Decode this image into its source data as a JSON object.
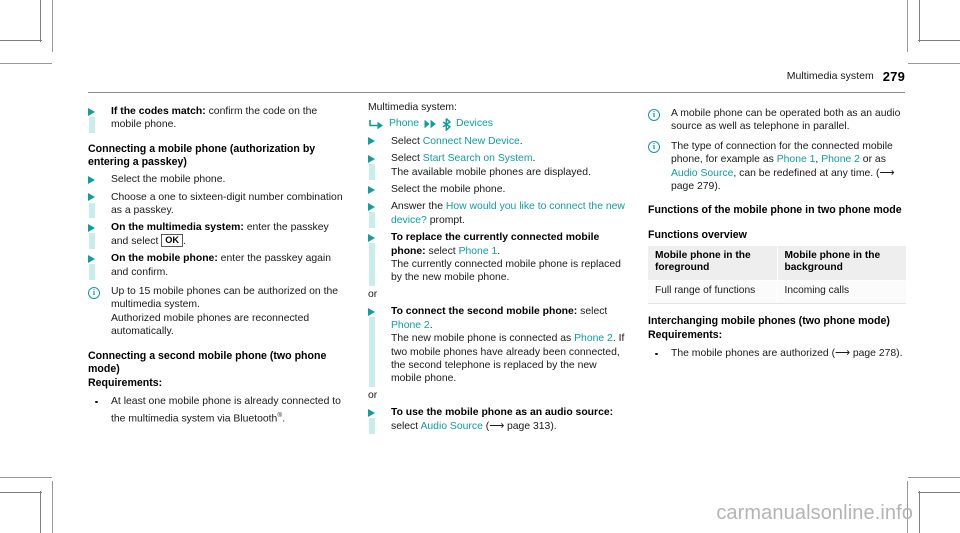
{
  "header": {
    "chapter": "Multimedia system",
    "page_number": "279"
  },
  "watermark": "carmanualsonline.info",
  "column1": {
    "step_codes_match": {
      "bold": "If the codes match:",
      "rest": " confirm the code on the mobile phone."
    },
    "heading_connect_passkey": "Connecting a mobile phone (authorization by entering a passkey)",
    "step_select_phone": "Select the mobile phone.",
    "step_choose_number": "Choose a one to sixteen-digit number combination as a passkey.",
    "step_multimedia": {
      "bold": "On the multimedia system:",
      "rest": " enter the passkey and select ",
      "key": "OK",
      "tail": "."
    },
    "step_mobile_phone": {
      "bold": "On the mobile phone:",
      "rest": " enter the passkey again and confirm."
    },
    "note_up_to_15": "Up to 15 mobile phones can be authorized on the multimedia system.\nAuthorized mobile phones are reconnected automatically.",
    "note_up_to_15_line1": "Up to 15 mobile phones can be authorized on the multimedia system.",
    "note_up_to_15_line2": "Authorized mobile phones are reconnected automatically.",
    "heading_second_phone": "Connecting a second mobile phone (two phone mode)",
    "heading_requirements": "Requirements:",
    "requirement_1": {
      "text_before": "At least one mobile phone is already connected to the multimedia system via Bluetooth",
      "superscript": "®",
      "text_after": "."
    }
  },
  "column2": {
    "intro": "Multimedia system:",
    "menu_path": {
      "turn_arrow_icon": "turn-arrow-icon",
      "item1": "Phone",
      "chevron_icon": "double-chevron-right-icon",
      "bluetooth_icon": "bluetooth-icon",
      "item2": "Devices"
    },
    "step_connect_new": {
      "prefix": "Select ",
      "link": "Connect New Device",
      "suffix": "."
    },
    "step_start_search": {
      "prefix": "Select ",
      "link": "Start Search on System",
      "suffix": ".",
      "result": "The available mobile phones are displayed."
    },
    "step_select_phone": "Select the mobile phone.",
    "step_answer_prompt": {
      "prefix": "Answer the ",
      "link": "How would you like to connect the new device?",
      "suffix": " prompt."
    },
    "step_replace": {
      "bold": "To replace the currently connected mobile phone:",
      "mid": " select ",
      "link": "Phone 1",
      "suffix": ".",
      "result": "The currently connected mobile phone is replaced by the new mobile phone."
    },
    "or_1": "or",
    "step_connect_second": {
      "bold": "To connect the second mobile phone:",
      "mid": " select ",
      "link": "Phone 2",
      "suffix": ".",
      "result_a": "The new mobile phone is connected as ",
      "result_link": "Phone 2",
      "result_b": ". If two mobile phones have already been connected, the second telephone is replaced by the new mobile phone."
    },
    "or_2": "or",
    "step_audio_source": {
      "bold": "To use the mobile phone as an audio source:",
      "mid": " select ",
      "link": "Audio Source",
      "ref": " (⟶ page 313)."
    }
  },
  "column3": {
    "note_parallel": "A mobile phone can be operated both as an audio source as well as telephone in parallel.",
    "note_type_of_connection": {
      "a": "The type of connection for the connected mobile phone, for example as ",
      "link1": "Phone 1",
      "b": ", ",
      "link2": "Phone 2",
      "c": " or as ",
      "link3": "Audio Source",
      "d": ", can be redefined at any time. (⟶ page 279)."
    },
    "heading_functions_two_phone": "Functions of the mobile phone in two phone mode",
    "heading_functions_overview": "Functions overview",
    "table": {
      "headers": [
        "Mobile phone in the foreground",
        "Mobile phone in the background"
      ],
      "rows": [
        [
          "Full range of functions",
          "Incoming calls"
        ]
      ]
    },
    "heading_interchanging": "Interchanging mobile phones (two phone mode)",
    "heading_requirements": "Requirements:",
    "requirement_1": "The mobile phones are authorized (⟶ page 278)."
  },
  "colors": {
    "accent_teal": "#0e9e9e",
    "marker_bar": "#c9ecec",
    "table_header_bg": "#eeeeee",
    "watermark": "#b4b4b4"
  }
}
